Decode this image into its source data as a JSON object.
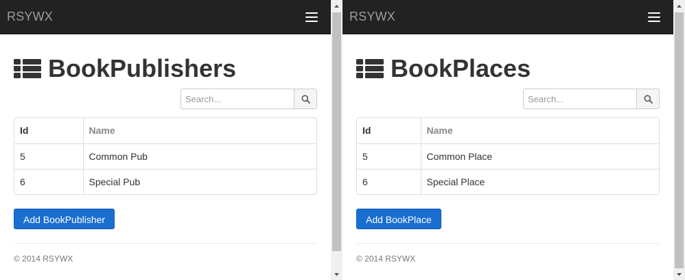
{
  "left": {
    "brand": "RSYWX",
    "title": "BookPublishers",
    "search": {
      "placeholder": "Search..."
    },
    "table": {
      "headers": [
        "Id",
        "Name"
      ],
      "rows": [
        [
          "5",
          "Common Pub"
        ],
        [
          "6",
          "Special Pub"
        ]
      ]
    },
    "add_button": "Add BookPublisher",
    "footer": "© 2014 RSYWX"
  },
  "right": {
    "brand": "RSYWX",
    "title": "BookPlaces",
    "search": {
      "placeholder": "Search..."
    },
    "table": {
      "headers": [
        "Id",
        "Name"
      ],
      "rows": [
        [
          "5",
          "Common Place"
        ],
        [
          "6",
          "Special Place"
        ]
      ]
    },
    "add_button": "Add BookPlace",
    "footer": "© 2014 RSYWX"
  },
  "colors": {
    "navbar": "#222222",
    "brand_text": "#9d9d9d",
    "primary_button": "#1a6ed0"
  },
  "icons": [
    "list-icon",
    "search-icon",
    "menu-icon",
    "scroll-up-icon",
    "scroll-down-icon"
  ]
}
